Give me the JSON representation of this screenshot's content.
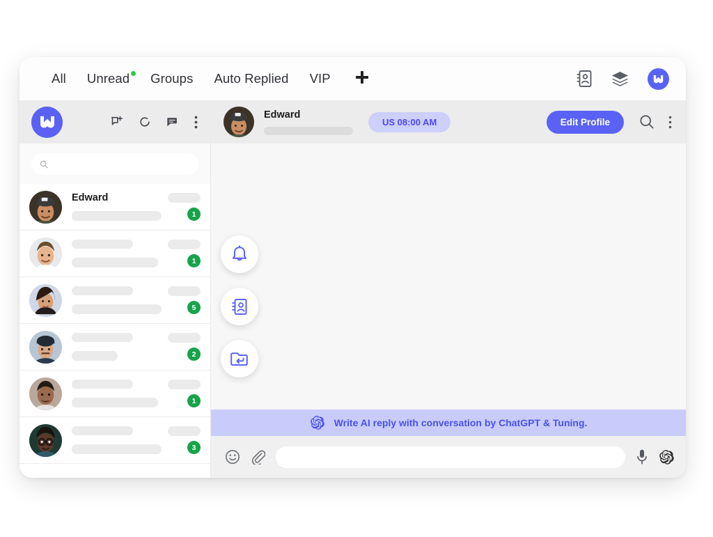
{
  "topbar": {
    "tabs": [
      {
        "label": "All",
        "dot": false
      },
      {
        "label": "Unread",
        "dot": true
      },
      {
        "label": "Groups",
        "dot": false
      },
      {
        "label": "Auto Replied",
        "dot": false
      },
      {
        "label": "VIP",
        "dot": false
      }
    ],
    "add_tab_label": "+",
    "icons": [
      "contact-book-icon",
      "layers-icon"
    ],
    "brand_letter": "W"
  },
  "sidebar": {
    "logo_letter": "W",
    "header_icons": [
      "new-chat-icon",
      "sync-icon",
      "message-icon",
      "more-vertical-icon"
    ],
    "search": {
      "value": "",
      "placeholder": ""
    },
    "chats": [
      {
        "name": "Edward",
        "badge": "1",
        "has_name": true
      },
      {
        "name": "",
        "badge": "1",
        "has_name": false
      },
      {
        "name": "",
        "badge": "5",
        "has_name": false
      },
      {
        "name": "",
        "badge": "2",
        "has_name": false
      },
      {
        "name": "",
        "badge": "1",
        "has_name": false
      },
      {
        "name": "",
        "badge": "3",
        "has_name": false
      }
    ]
  },
  "conversation": {
    "contact_name": "Edward",
    "time_badge": "US 08:00 AM",
    "edit_profile_label": "Edit Profile",
    "header_icons": [
      "search-icon",
      "more-vertical-icon"
    ],
    "fab_buttons": [
      "bell-icon",
      "contact-card-icon",
      "folder-reply-icon"
    ],
    "ai_banner": {
      "icon": "openai-icon",
      "text": "Write AI reply with conversation by ChatGPT & Tuning."
    },
    "composer": {
      "emoji_icon": "smiley-icon",
      "attach_icon": "paperclip-icon",
      "value": "",
      "placeholder": "",
      "mic_icon": "microphone-icon",
      "ai_icon": "openai-icon"
    }
  },
  "colors": {
    "brand_purple": "#5a62f5",
    "badge_green": "#16a34a",
    "banner_bg": "#c9ccfb",
    "chip_bg": "#ccd0fb"
  }
}
